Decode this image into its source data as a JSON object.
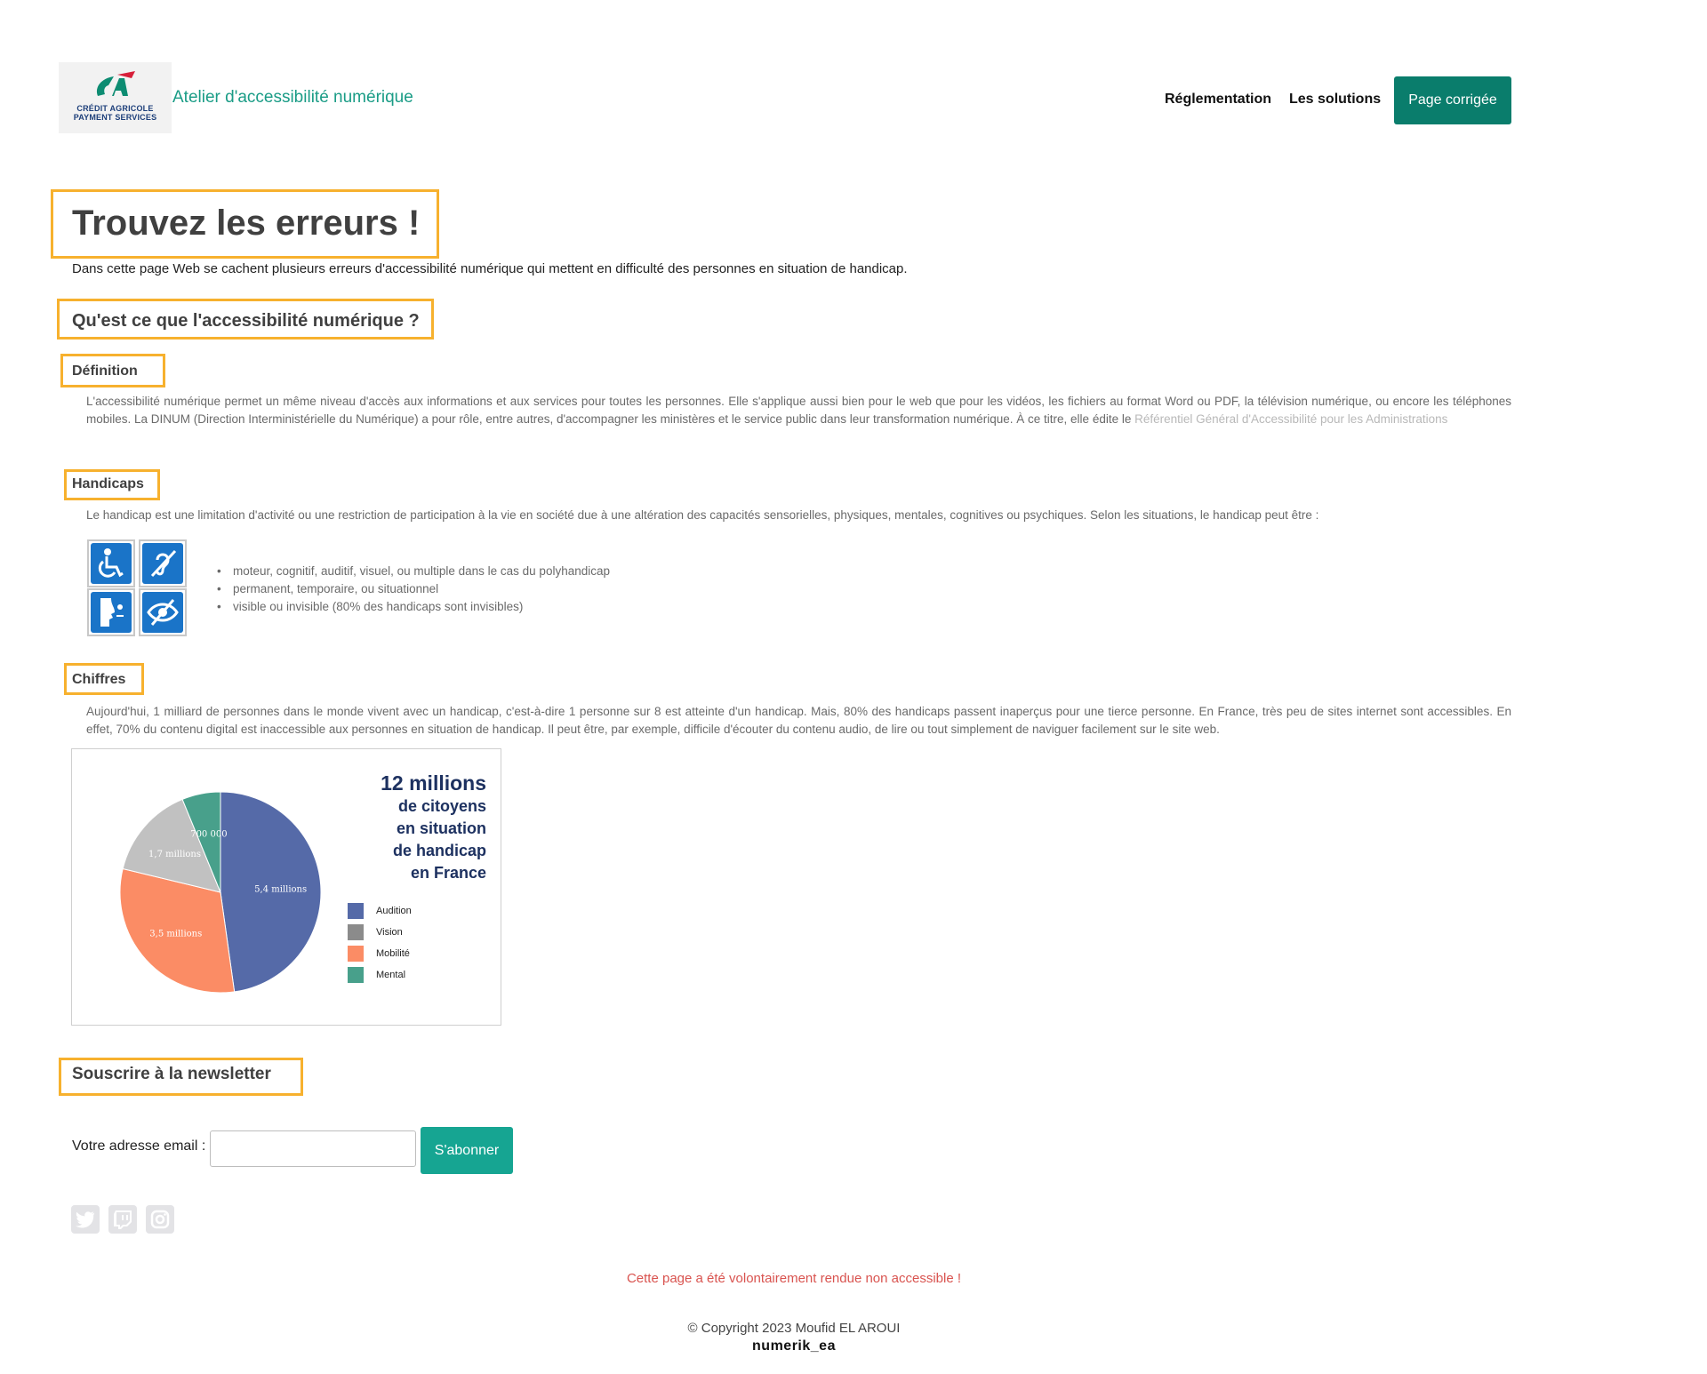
{
  "header": {
    "logo_line1": "CRÉDIT AGRICOLE",
    "logo_line2": "PAYMENT SERVICES",
    "site_title": "Atelier d'accessibilité numérique",
    "nav": [
      {
        "label": "Réglementation"
      },
      {
        "label": "Les solutions"
      }
    ],
    "cta_label": "Page corrigée"
  },
  "main": {
    "title": "Trouvez les erreurs !",
    "intro": "Dans cette page Web se cachent plusieurs erreurs d'accessibilité numérique qui mettent en difficulté des personnes en situation de handicap.",
    "section_title": "Qu'est ce que l'accessibilité numérique ?",
    "definition": {
      "heading": "Définition",
      "text": "L'accessibilité numérique permet un même niveau d'accès aux informations et aux services pour toutes les personnes. Elle s'applique aussi bien pour le web que pour les vidéos, les fichiers au format Word ou PDF, la télévision numérique, ou encore les téléphones mobiles. La DINUM (Direction Interministérielle du Numérique) a pour rôle, entre autres, d'accompagner les ministères et le service public dans leur transformation numérique. À ce titre, elle édite le ",
      "link": "Référentiel Général d'Accessibilité pour les Administrations"
    },
    "handicaps": {
      "heading": "Handicaps",
      "text": "Le handicap est une limitation d'activité ou une restriction de participation à la vie en société due à une altération des capacités sensorielles, physiques, mentales, cognitives ou psychiques. Selon les situations, le handicap peut être :",
      "icons": [
        "wheelchair-icon",
        "hearing-icon",
        "mental-icon",
        "vision-icon"
      ],
      "items": [
        "moteur, cognitif, auditif, visuel, ou multiple dans le cas du polyhandicap",
        "permanent, temporaire, ou situationnel",
        "visible ou invisible (80% des handicaps sont invisibles)"
      ]
    },
    "chiffres": {
      "heading": "Chiffres",
      "text": "Aujourd'hui, 1 milliard de personnes dans le monde vivent avec un handicap, c'est-à-dire 1 personne sur 8 est atteinte d'un handicap. Mais, 80% des handicaps passent inaperçus pour une tierce personne. En France, très peu de sites internet sont accessibles. En effet, 70% du contenu digital est inaccessible aux personnes en situation de handicap. Il peut être, par exemple, difficile d'écouter du contenu audio, de lire ou tout simplement de naviguer facilement sur le site web."
    }
  },
  "chart_data": {
    "type": "pie",
    "title_big": "12 millions",
    "title_lines": [
      "de citoyens",
      "en situation",
      "de handicap",
      "en France"
    ],
    "series": [
      {
        "name": "Audition",
        "value": 5.4,
        "label": "5,4 millions",
        "color": "#556aa8"
      },
      {
        "name": "Mobilité",
        "value": 3.5,
        "label": "3,5 millions",
        "color": "#fb8c65"
      },
      {
        "name": "Vision",
        "value": 1.7,
        "label": "1,7 millions",
        "color": "#c1c1c1"
      },
      {
        "name": "Mental",
        "value": 0.7,
        "label": "700 000",
        "color": "#48a08b"
      }
    ],
    "legend": [
      {
        "name": "Audition",
        "color": "#556aa8"
      },
      {
        "name": "Vision",
        "color": "#8b8b8b"
      },
      {
        "name": "Mobilité",
        "color": "#fb8c65"
      },
      {
        "name": "Mental",
        "color": "#48a08b"
      }
    ]
  },
  "newsletter": {
    "heading": "Souscrire à la newsletter",
    "label": "Votre adresse email :",
    "value": "",
    "button": "S'abonner"
  },
  "social": [
    "twitter-icon",
    "twitch-icon",
    "instagram-icon"
  ],
  "footer": {
    "warning": "Cette page a été volontairement rendue non accessible !",
    "copyright": "© Copyright 2023 Moufid EL AROUI",
    "brand": "numerik_ea"
  }
}
